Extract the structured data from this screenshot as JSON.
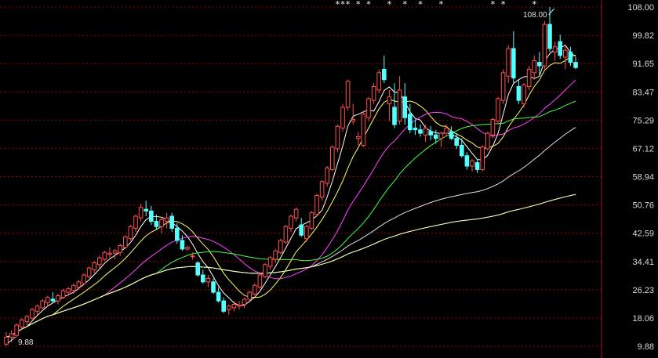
{
  "chart_data": {
    "type": "candlestick",
    "ylim": [
      9.88,
      108.0
    ],
    "y_ticks": [
      "108.00",
      "99.82",
      "91.65",
      "83.47",
      "75.29",
      "67.12",
      "58.94",
      "50.76",
      "42.59",
      "34.41",
      "26.23",
      "18.06",
      "9.88"
    ],
    "annotations": [
      {
        "text": "108.00",
        "x": 106,
        "y": 108.0
      },
      {
        "text": "9.88",
        "x": 0,
        "y": 9.88
      }
    ],
    "marker_symbol": "*",
    "marker_positions": [
      64,
      65,
      66,
      68,
      70,
      74,
      77,
      80,
      84,
      94,
      96,
      102
    ],
    "colors": {
      "up": "#ff5050",
      "down": "#54ffff",
      "grid": "#9a0000",
      "axis": "#b01010"
    },
    "candles": [
      [
        10.5,
        14.0,
        9.88,
        12.5
      ],
      [
        12.5,
        14.5,
        11.0,
        13.5
      ],
      [
        13.0,
        16.5,
        12.5,
        16.0
      ],
      [
        15.5,
        18.0,
        14.5,
        17.5
      ],
      [
        17.0,
        19.0,
        16.0,
        18.5
      ],
      [
        18.0,
        21.0,
        17.5,
        20.5
      ],
      [
        20.0,
        22.0,
        19.0,
        21.5
      ],
      [
        21.0,
        23.5,
        20.5,
        23.0
      ],
      [
        22.5,
        24.5,
        21.5,
        24.0
      ],
      [
        23.5,
        25.5,
        22.5,
        23.0
      ],
      [
        23.0,
        25.0,
        22.0,
        24.5
      ],
      [
        24.0,
        26.5,
        23.5,
        26.0
      ],
      [
        25.5,
        27.0,
        24.5,
        26.5
      ],
      [
        26.0,
        28.0,
        25.0,
        27.5
      ],
      [
        27.0,
        29.0,
        26.5,
        28.5
      ],
      [
        28.0,
        31.0,
        27.5,
        30.5
      ],
      [
        30.0,
        33.0,
        29.5,
        32.5
      ],
      [
        32.0,
        34.5,
        31.0,
        34.0
      ],
      [
        33.5,
        36.0,
        32.5,
        35.5
      ],
      [
        35.0,
        37.5,
        34.5,
        37.0
      ],
      [
        36.5,
        38.5,
        35.5,
        36.8
      ],
      [
        36.8,
        38.0,
        35.0,
        37.5
      ],
      [
        37.0,
        39.5,
        36.0,
        39.0
      ],
      [
        38.5,
        42.0,
        38.0,
        41.5
      ],
      [
        41.0,
        45.0,
        40.5,
        44.5
      ],
      [
        44.0,
        48.0,
        43.0,
        47.5
      ],
      [
        47.0,
        51.0,
        46.0,
        50.0
      ],
      [
        49.5,
        52.0,
        47.5,
        49.0
      ],
      [
        49.0,
        50.5,
        45.0,
        46.0
      ],
      [
        46.0,
        48.0,
        43.5,
        44.5
      ],
      [
        44.5,
        47.0,
        42.5,
        46.5
      ],
      [
        46.0,
        48.5,
        44.0,
        47.0
      ],
      [
        47.5,
        48.5,
        43.0,
        44.0
      ],
      [
        44.0,
        45.5,
        39.5,
        40.5
      ],
      [
        40.5,
        42.0,
        37.5,
        38.0
      ],
      [
        38.0,
        39.0,
        37.5,
        38.5
      ],
      [
        36.0,
        37.0,
        35.0,
        36.0
      ],
      [
        34.0,
        34.5,
        30.0,
        30.5
      ],
      [
        30.5,
        32.0,
        28.0,
        28.5
      ],
      [
        28.5,
        30.5,
        27.0,
        29.5
      ],
      [
        28.5,
        29.5,
        25.0,
        25.5
      ],
      [
        25.5,
        27.0,
        22.5,
        23.0
      ],
      [
        23.0,
        24.0,
        19.5,
        20.0
      ],
      [
        20.5,
        22.0,
        19.0,
        21.5
      ],
      [
        21.0,
        23.0,
        20.0,
        22.0
      ],
      [
        21.5,
        23.0,
        20.5,
        21.8
      ],
      [
        22.0,
        24.0,
        21.0,
        23.5
      ],
      [
        23.5,
        26.0,
        23.0,
        25.5
      ],
      [
        25.0,
        28.0,
        24.5,
        27.5
      ],
      [
        27.0,
        31.0,
        26.5,
        30.5
      ],
      [
        30.0,
        34.0,
        29.5,
        33.5
      ],
      [
        33.0,
        36.0,
        32.0,
        35.5
      ],
      [
        35.0,
        38.0,
        34.0,
        37.5
      ],
      [
        37.0,
        41.0,
        36.5,
        40.5
      ],
      [
        40.0,
        45.0,
        39.5,
        44.5
      ],
      [
        44.0,
        48.0,
        43.0,
        47.5
      ],
      [
        47.0,
        50.0,
        46.0,
        49.5
      ],
      [
        45.0,
        47.0,
        41.5,
        42.0
      ],
      [
        41.0,
        45.0,
        40.0,
        44.5
      ],
      [
        44.0,
        49.0,
        43.5,
        48.5
      ],
      [
        48.0,
        54.0,
        47.5,
        53.5
      ],
      [
        53.0,
        58.0,
        52.0,
        57.5
      ],
      [
        57.0,
        62.0,
        56.0,
        61.5
      ],
      [
        61.0,
        68.0,
        60.5,
        67.5
      ],
      [
        67.0,
        74.0,
        66.0,
        73.5
      ],
      [
        73.0,
        80.0,
        72.0,
        79.0
      ],
      [
        79.0,
        87.0,
        78.0,
        86.5
      ],
      [
        75.0,
        80.0,
        74.0,
        75.5
      ],
      [
        70.0,
        72.0,
        68.0,
        70.5
      ],
      [
        68.0,
        78.0,
        67.5,
        77.0
      ],
      [
        76.0,
        82.0,
        75.0,
        81.5
      ],
      [
        81.0,
        86.0,
        80.0,
        85.0
      ],
      [
        84.0,
        90.0,
        83.0,
        89.0
      ],
      [
        90.0,
        94.0,
        86.0,
        87.0
      ],
      [
        80.0,
        84.0,
        75.0,
        82.0
      ],
      [
        79.0,
        86.0,
        73.0,
        74.0
      ],
      [
        75.0,
        88.0,
        74.0,
        84.0
      ],
      [
        82.0,
        86.0,
        74.0,
        76.0
      ],
      [
        77.0,
        80.0,
        71.5,
        72.5
      ],
      [
        73.0,
        75.5,
        71.0,
        72.5
      ],
      [
        72.5,
        74.0,
        70.5,
        71.5
      ],
      [
        71.0,
        74.0,
        69.0,
        73.0
      ],
      [
        72.0,
        73.5,
        69.5,
        71.0
      ],
      [
        71.0,
        72.5,
        68.5,
        70.0
      ],
      [
        70.0,
        72.0,
        67.5,
        71.5
      ],
      [
        71.5,
        74.0,
        70.5,
        73.0
      ],
      [
        72.0,
        73.5,
        69.5,
        70.0
      ],
      [
        70.0,
        71.5,
        67.0,
        68.0
      ],
      [
        68.0,
        70.0,
        64.5,
        65.0
      ],
      [
        65.0,
        66.0,
        61.0,
        62.0
      ],
      [
        62.0,
        64.0,
        60.5,
        63.5
      ],
      [
        63.0,
        64.0,
        60.0,
        61.0
      ],
      [
        61.0,
        68.0,
        60.5,
        67.5
      ],
      [
        67.0,
        72.0,
        66.5,
        71.5
      ],
      [
        71.0,
        76.0,
        70.0,
        75.5
      ],
      [
        75.0,
        82.0,
        74.0,
        81.5
      ],
      [
        81.0,
        90.0,
        80.0,
        89.0
      ],
      [
        88.0,
        97.0,
        86.0,
        96.0
      ],
      [
        96.0,
        101.0,
        86.0,
        87.5
      ],
      [
        85.0,
        87.0,
        80.0,
        81.0
      ],
      [
        80.0,
        86.0,
        79.0,
        85.5
      ],
      [
        85.0,
        91.0,
        84.0,
        90.0
      ],
      [
        89.0,
        94.0,
        87.0,
        92.5
      ],
      [
        92.0,
        95.0,
        88.5,
        91.0
      ],
      [
        91.0,
        104.0,
        90.0,
        103.0
      ],
      [
        103.0,
        108.0,
        95.0,
        96.0
      ],
      [
        95.0,
        98.0,
        92.5,
        96.5
      ],
      [
        98.0,
        100.0,
        93.0,
        94.0
      ],
      [
        93.5,
        97.0,
        90.0,
        95.5
      ],
      [
        95.0,
        96.5,
        91.0,
        92.0
      ],
      [
        92.0,
        93.5,
        90.0,
        90.5
      ]
    ]
  }
}
